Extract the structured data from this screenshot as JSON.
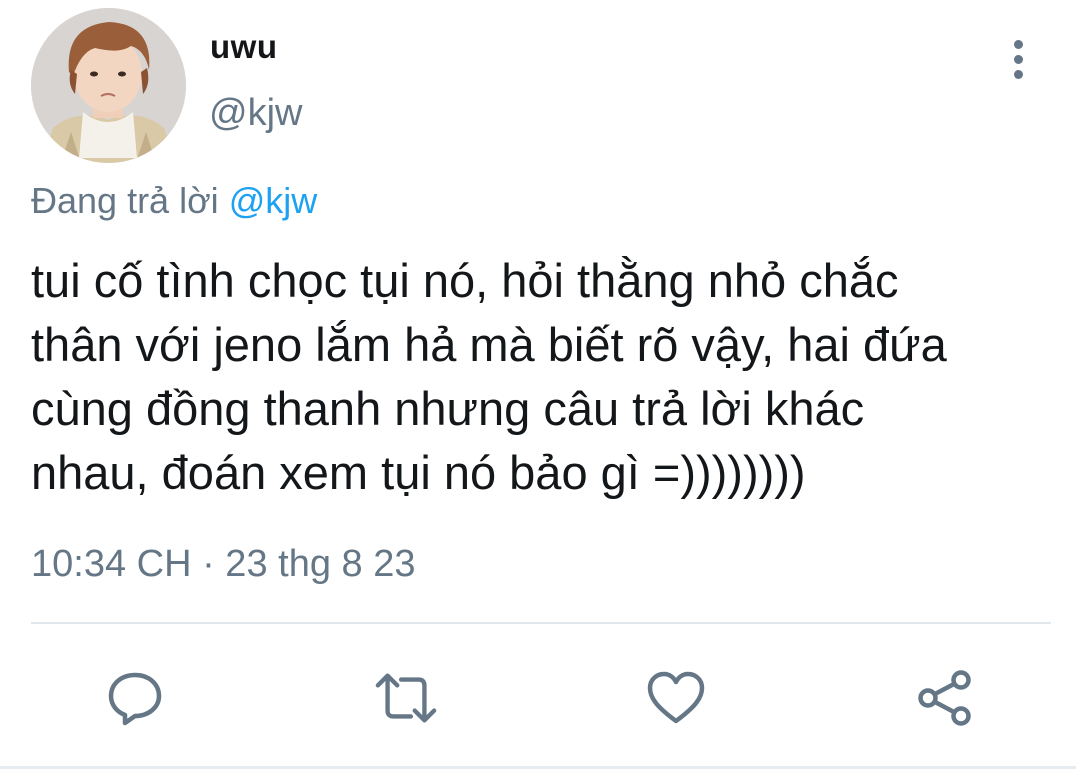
{
  "user": {
    "display_name": "uwu",
    "handle": "@kjw"
  },
  "reply": {
    "prefix": "Đang trả lời ",
    "mention": "@kjw"
  },
  "tweet": {
    "lines": [
      "tui cố tình chọc tụi nó, hỏi thằng nhỏ chắc",
      "thân với jeno lắm hả mà biết rõ vậy, hai đứa",
      "cùng đồng thanh nhưng câu trả lời khác",
      "nhau, đoán xem tụi nó bảo gì =))))))))"
    ],
    "timestamp": "10:34 CH · 23 thg 8 23"
  },
  "actions": {
    "reply_icon": "comment-icon",
    "retweet_icon": "retweet-icon",
    "like_icon": "heart-icon",
    "share_icon": "share-icon",
    "more_icon": "more-vertical-icon"
  },
  "colors": {
    "text": "#14171a",
    "secondary": "#657786",
    "accent": "#1da1f2",
    "divider": "#e1e8ed"
  }
}
